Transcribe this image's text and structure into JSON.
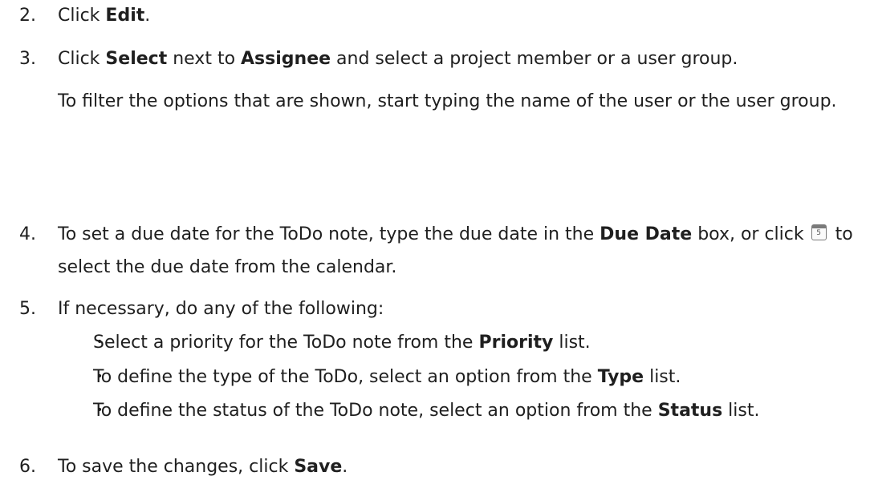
{
  "steps": {
    "s2": {
      "num": "2.",
      "t1": "Click ",
      "b1": "Edit",
      "t2": "."
    },
    "s3": {
      "num": "3.",
      "t1": "Click ",
      "b1": "Select",
      "t2": " next to ",
      "b2": "Assignee",
      "t3": " and select a project member or a user group.",
      "note": "To filter the options that are shown, start typing the name of the user or the user group."
    },
    "s4": {
      "num": "4.",
      "t1": "To set a due date for the ToDo note, type the due date in the ",
      "b1": "Due Date",
      "t2": " box, or click ",
      "icon": "calendar-icon",
      "icon_glyph": "5",
      "t3": " to select the due date from the calendar."
    },
    "s5": {
      "num": "5.",
      "text": "If necessary, do any of the following:",
      "bullets": [
        {
          "t1": "Select a priority for the ToDo note from the ",
          "b": "Priority",
          "t2": " list."
        },
        {
          "t1": "To define the type of the ToDo, select an option from the ",
          "b": "Type",
          "t2": " list."
        },
        {
          "t1": "To define the status of the ToDo note, select an option from the ",
          "b": "Status",
          "t2": " list."
        }
      ]
    },
    "s6": {
      "num": "6.",
      "t1": "To save the changes, click ",
      "b1": "Save",
      "t2": "."
    }
  },
  "bullet_char": "•"
}
